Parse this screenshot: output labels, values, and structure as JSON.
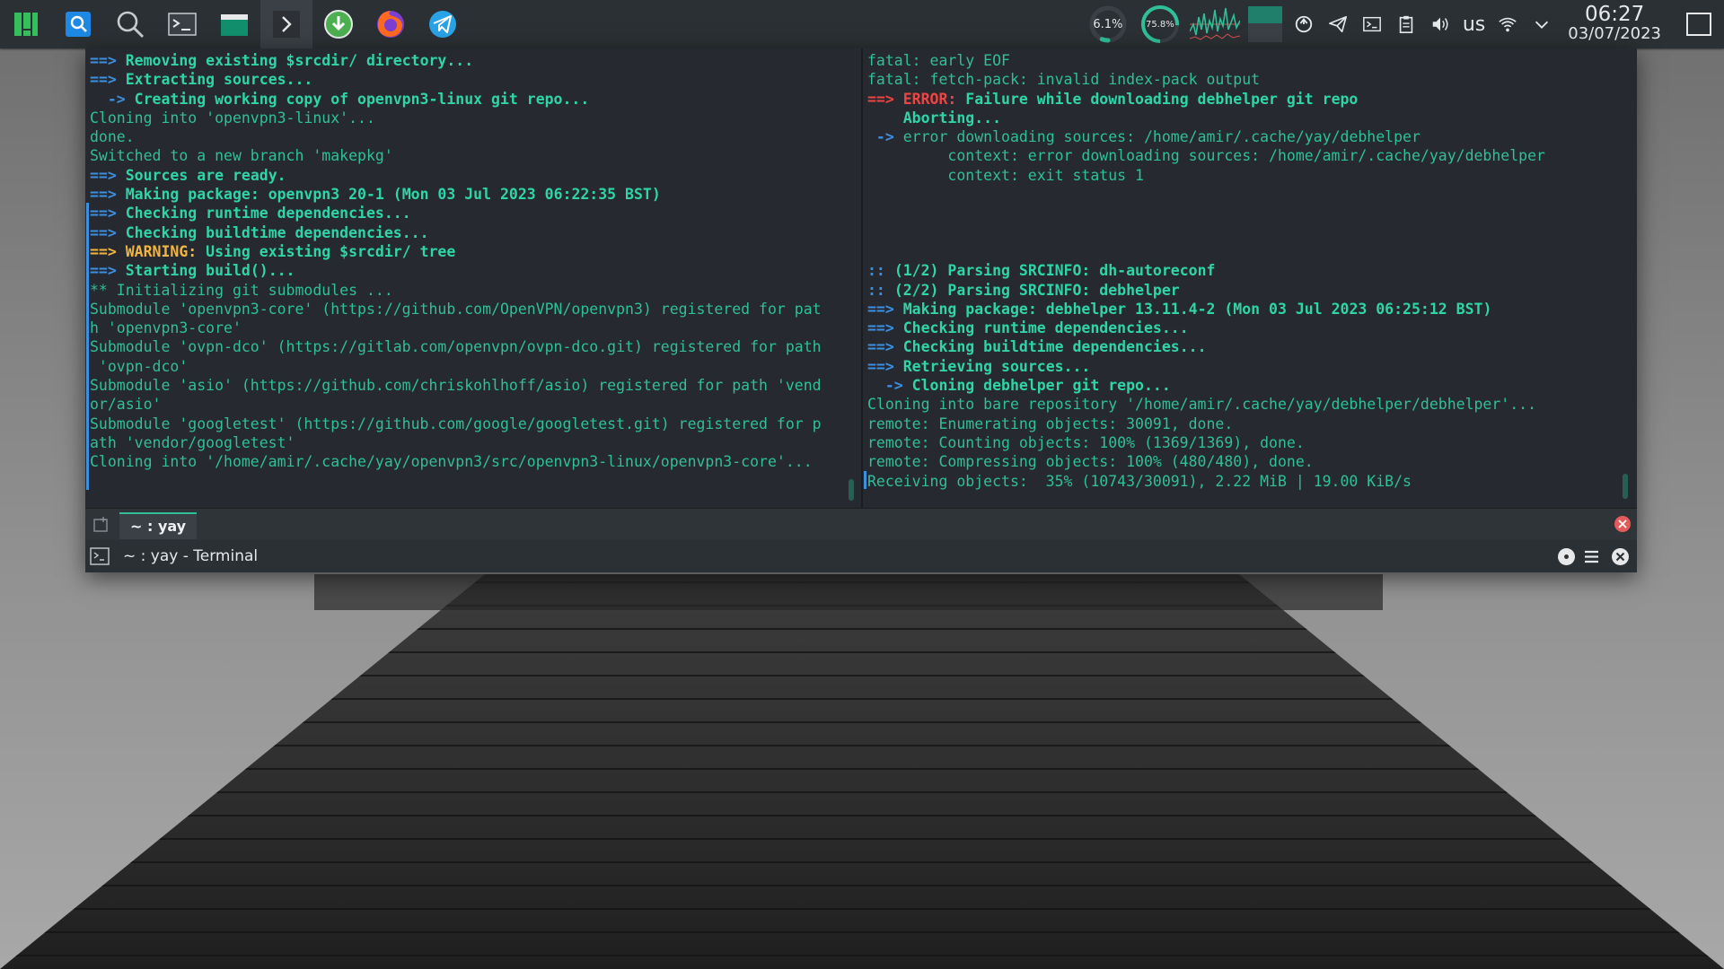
{
  "panel": {
    "launchers": [
      {
        "name": "app-menu-icon",
        "active": false
      },
      {
        "name": "krunner-icon",
        "active": false
      },
      {
        "name": "search-icon",
        "active": false
      },
      {
        "name": "terminal-icon",
        "active": false
      },
      {
        "name": "file-manager-icon",
        "active": false
      },
      {
        "name": "konsole-icon",
        "active": true
      },
      {
        "name": "download-manager-icon",
        "active": false
      },
      {
        "name": "firefox-icon",
        "active": false
      },
      {
        "name": "telegram-icon",
        "active": false
      }
    ],
    "monitors": {
      "cpu_label": "6.1%",
      "cpu_fraction": 0.061,
      "memory_label": "75.8%",
      "memory_fraction": 0.758
    },
    "keyboard_layout": "us",
    "clock_time": "06:27",
    "clock_date": "03/07/2023",
    "colors": {
      "accent": "#2fbf99",
      "panel_bg": "#2b3034"
    }
  },
  "terminal": {
    "tab_label": "~ : yay",
    "window_title": "~ : yay - Terminal",
    "left_pane": [
      [
        {
          "c": "bl b",
          "t": "==> "
        },
        {
          "c": "g b",
          "t": "Removing existing $srcdir/ directory..."
        }
      ],
      [
        {
          "c": "bl b",
          "t": "==> "
        },
        {
          "c": "g b",
          "t": "Extracting sources..."
        }
      ],
      [
        {
          "c": "bl b",
          "t": "  -> "
        },
        {
          "c": "g b",
          "t": "Creating working copy of openvpn3-linux git repo..."
        }
      ],
      [
        {
          "c": "n",
          "t": "Cloning into 'openvpn3-linux'..."
        }
      ],
      [
        {
          "c": "n",
          "t": "done."
        }
      ],
      [
        {
          "c": "n",
          "t": "Switched to a new branch 'makepkg'"
        }
      ],
      [
        {
          "c": "bl b",
          "t": "==> "
        },
        {
          "c": "g b",
          "t": "Sources are ready."
        }
      ],
      [
        {
          "c": "bl b",
          "t": "==> "
        },
        {
          "c": "g b",
          "t": "Making package: openvpn3 20-1 (Mon 03 Jul 2023 06:22:35 BST)"
        }
      ],
      [
        {
          "c": "bl b",
          "t": "==> "
        },
        {
          "c": "g b",
          "t": "Checking runtime dependencies..."
        }
      ],
      [
        {
          "c": "bl b",
          "t": "==> "
        },
        {
          "c": "g b",
          "t": "Checking buildtime dependencies..."
        }
      ],
      [
        {
          "c": "y b",
          "t": "==> WARNING:"
        },
        {
          "c": "g b",
          "t": " Using existing $srcdir/ tree"
        }
      ],
      [
        {
          "c": "bl b",
          "t": "==> "
        },
        {
          "c": "g b",
          "t": "Starting build()..."
        }
      ],
      [
        {
          "c": "n",
          "t": "** Initializing git submodules ..."
        }
      ],
      [
        {
          "c": "n",
          "t": "Submodule 'openvpn3-core' (https://github.com/OpenVPN/openvpn3) registered for pat"
        }
      ],
      [
        {
          "c": "n",
          "t": "h 'openvpn3-core'"
        }
      ],
      [
        {
          "c": "n",
          "t": "Submodule 'ovpn-dco' (https://gitlab.com/openvpn/ovpn-dco.git) registered for path"
        }
      ],
      [
        {
          "c": "n",
          "t": " 'ovpn-dco'"
        }
      ],
      [
        {
          "c": "n",
          "t": "Submodule 'asio' (https://github.com/chriskohlhoff/asio) registered for path 'vend"
        }
      ],
      [
        {
          "c": "n",
          "t": "or/asio'"
        }
      ],
      [
        {
          "c": "n",
          "t": "Submodule 'googletest' (https://github.com/google/googletest.git) registered for p"
        }
      ],
      [
        {
          "c": "n",
          "t": "ath 'vendor/googletest'"
        }
      ],
      [
        {
          "c": "n",
          "t": "Cloning into '/home/amir/.cache/yay/openvpn3/src/openvpn3-linux/openvpn3-core'..."
        }
      ]
    ],
    "right_pane": [
      [
        {
          "c": "n",
          "t": "fatal: early EOF"
        }
      ],
      [
        {
          "c": "n",
          "t": "fatal: fetch-pack: invalid index-pack output"
        }
      ],
      [
        {
          "c": "r b",
          "t": "==> ERROR:"
        },
        {
          "c": "g b",
          "t": " Failure while downloading debhelper git repo"
        }
      ],
      [
        {
          "c": "g b",
          "t": "    Aborting..."
        }
      ],
      [
        {
          "c": "bl b",
          "t": " -> "
        },
        {
          "c": "n",
          "t": "error downloading sources: /home/amir/.cache/yay/debhelper"
        }
      ],
      [
        {
          "c": "n",
          "t": "         context: error downloading sources: /home/amir/.cache/yay/debhelper"
        }
      ],
      [
        {
          "c": "n",
          "t": "         context: exit status 1"
        }
      ],
      [
        {
          "c": "n",
          "t": ""
        }
      ],
      [
        {
          "c": "n",
          "t": ""
        }
      ],
      [
        {
          "c": "n",
          "t": ""
        }
      ],
      [
        {
          "c": "n",
          "t": ""
        }
      ],
      [
        {
          "c": "bl b",
          "t": ":: "
        },
        {
          "c": "g b",
          "t": "(1/2) Parsing SRCINFO: dh-autoreconf"
        }
      ],
      [
        {
          "c": "bl b",
          "t": ":: "
        },
        {
          "c": "g b",
          "t": "(2/2) Parsing SRCINFO: debhelper"
        }
      ],
      [
        {
          "c": "bl b",
          "t": "==> "
        },
        {
          "c": "g b",
          "t": "Making package: debhelper 13.11.4-2 (Mon 03 Jul 2023 06:25:12 BST)"
        }
      ],
      [
        {
          "c": "bl b",
          "t": "==> "
        },
        {
          "c": "g b",
          "t": "Checking runtime dependencies..."
        }
      ],
      [
        {
          "c": "bl b",
          "t": "==> "
        },
        {
          "c": "g b",
          "t": "Checking buildtime dependencies..."
        }
      ],
      [
        {
          "c": "bl b",
          "t": "==> "
        },
        {
          "c": "g b",
          "t": "Retrieving sources..."
        }
      ],
      [
        {
          "c": "bl b",
          "t": "  -> "
        },
        {
          "c": "g b",
          "t": "Cloning debhelper git repo..."
        }
      ],
      [
        {
          "c": "n",
          "t": "Cloning into bare repository '/home/amir/.cache/yay/debhelper/debhelper'..."
        }
      ],
      [
        {
          "c": "n",
          "t": "remote: Enumerating objects: 30091, done."
        }
      ],
      [
        {
          "c": "n",
          "t": "remote: Counting objects: 100% (1369/1369), done."
        }
      ],
      [
        {
          "c": "n",
          "t": "remote: Compressing objects: 100% (480/480), done."
        }
      ],
      [
        {
          "c": "n",
          "t": "Receiving objects:  35% (10743/30091), 2.22 MiB | 19.00 KiB/s"
        }
      ]
    ]
  }
}
